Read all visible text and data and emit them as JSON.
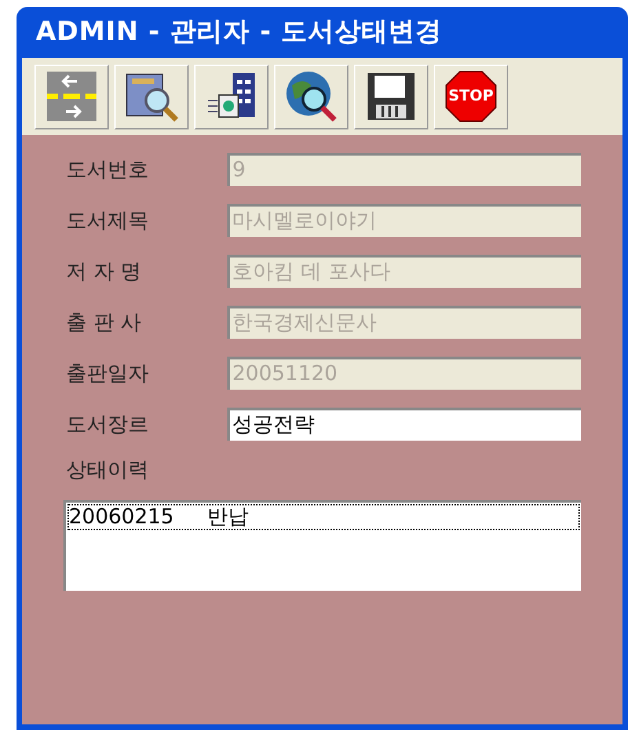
{
  "window": {
    "title": "ADMIN - 관리자 - 도서상태변경"
  },
  "toolbar": [
    {
      "kind": "road"
    },
    {
      "kind": "search"
    },
    {
      "kind": "export"
    },
    {
      "kind": "globe"
    },
    {
      "kind": "save"
    },
    {
      "kind": "stop",
      "label": "STOP"
    }
  ],
  "fields": [
    {
      "label": "도서번호",
      "value": "9",
      "disabled": true
    },
    {
      "label": "도서제목",
      "value": "마시멜로이야기",
      "disabled": true
    },
    {
      "label": "저 자 명",
      "value": "호아킴 데 포사다",
      "disabled": true
    },
    {
      "label": "출 판 사",
      "value": "한국경제신문사",
      "disabled": true
    },
    {
      "label": "출판일자",
      "value": "20051120",
      "disabled": true
    },
    {
      "label": "도서장르",
      "value": "성공전략",
      "disabled": false
    }
  ],
  "history": {
    "label": "상태이력",
    "items": [
      {
        "date": "20060215",
        "status": "반납",
        "selected": true
      }
    ]
  }
}
